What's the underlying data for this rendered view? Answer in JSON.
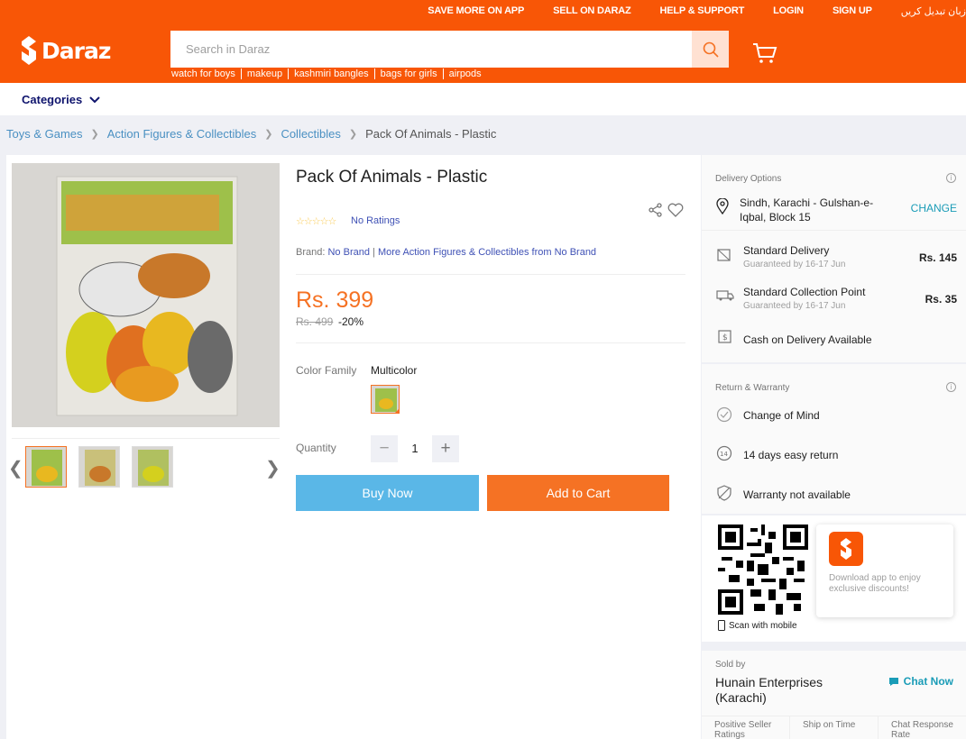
{
  "header": {
    "toplinks": [
      "SAVE MORE ON APP",
      "SELL ON DARAZ",
      "HELP & SUPPORT",
      "LOGIN",
      "SIGN UP",
      "زبان تبدیل کریں"
    ],
    "logo_text": "Daraz",
    "search_placeholder": "Search in Daraz",
    "quick_searches": [
      "watch for boys",
      "makeup",
      "kashmiri bangles",
      "bags for girls",
      "airpods"
    ],
    "categories_label": "Categories"
  },
  "breadcrumb": [
    "Toys & Games",
    "Action Figures & Collectibles",
    "Collectibles",
    "Pack Of Animals - Plastic"
  ],
  "product": {
    "title": "Pack Of Animals - Plastic",
    "ratings_text": "No Ratings",
    "rating_stars": 0,
    "brand_label": "Brand:",
    "brand_value": "No Brand",
    "brand_more": "More Action Figures & Collectibles from No Brand",
    "price": "Rs. 399",
    "old_price": "Rs. 499",
    "discount": "-20%",
    "color_family_label": "Color Family",
    "color_family_value": "Multicolor",
    "quantity_label": "Quantity",
    "quantity_value": "1",
    "buy_now": "Buy Now",
    "add_to_cart": "Add to Cart"
  },
  "delivery": {
    "heading": "Delivery Options",
    "location": "Sindh, Karachi - Gulshan-e-Iqbal, Block 15",
    "change": "CHANGE",
    "standard_delivery": "Standard Delivery",
    "standard_delivery_sub": "Guaranteed by 16-17 Jun",
    "standard_delivery_price": "Rs. 145",
    "collection_point": "Standard Collection Point",
    "collection_point_sub": "Guaranteed by 16-17 Jun",
    "collection_point_price": "Rs. 35",
    "cod": "Cash on Delivery Available"
  },
  "returns": {
    "heading": "Return & Warranty",
    "change_of_mind": "Change of Mind",
    "easy_return": "14 days easy return",
    "warranty": "Warranty not available"
  },
  "app": {
    "scan": "Scan with mobile",
    "promo": "Download app to enjoy exclusive discounts!"
  },
  "seller": {
    "sold_by": "Sold by",
    "name": "Hunain Enterprises (Karachi)",
    "chat": "Chat Now",
    "metrics": [
      "Positive Seller Ratings",
      "Ship on Time",
      "Chat Response Rate"
    ]
  },
  "colors": {
    "brand_orange": "#f85606",
    "price_orange": "#f57224",
    "buy_blue": "#5ab7e7",
    "link_blue": "#3f51b5"
  }
}
